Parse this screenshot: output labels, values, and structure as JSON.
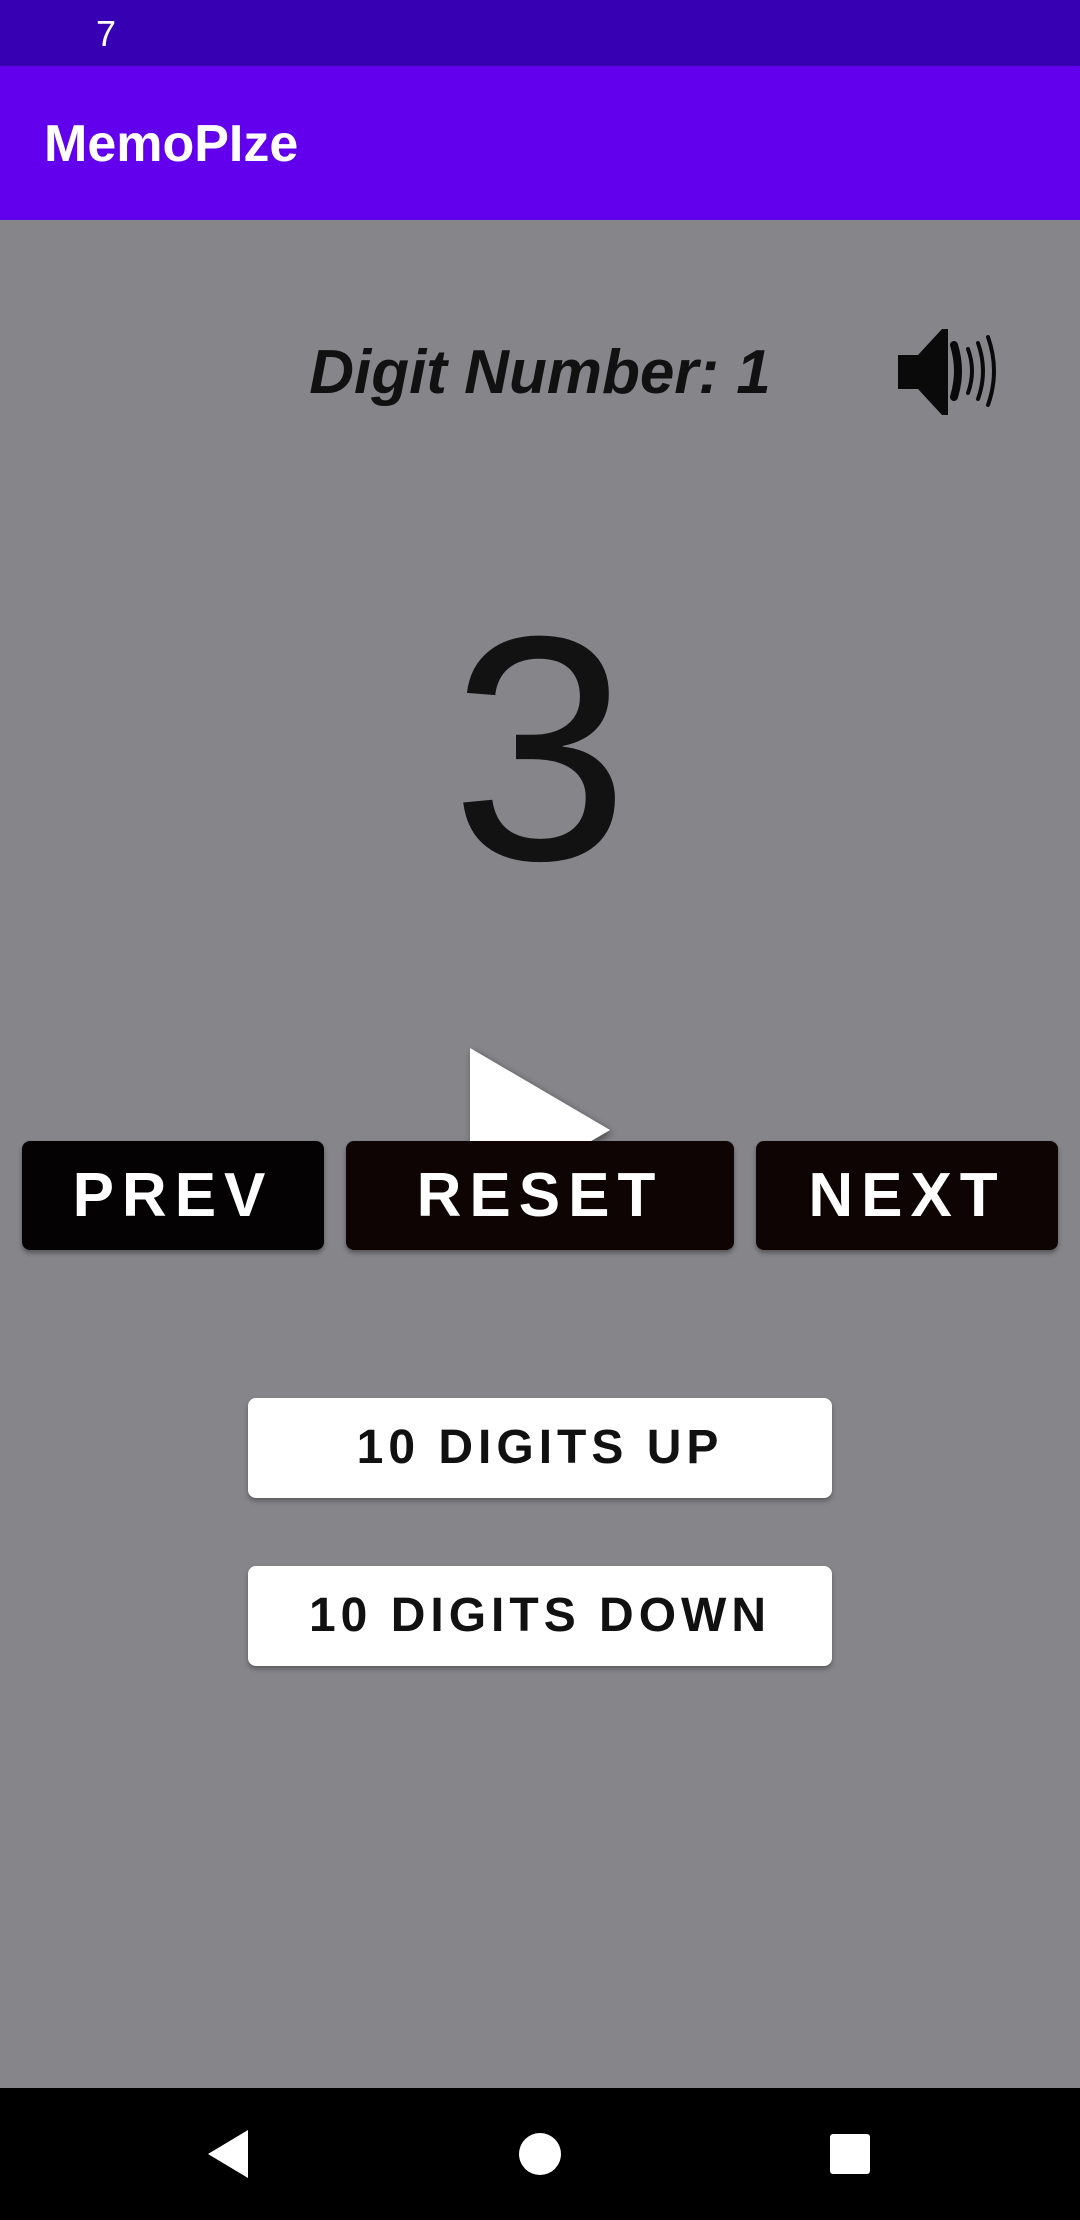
{
  "status_bar": {
    "time": "7"
  },
  "app_bar": {
    "title": "MemoPIze"
  },
  "main": {
    "digit_label": "Digit Number: 1",
    "current_digit": "3",
    "icons": {
      "sound": "speaker-volume-icon",
      "play": "play-icon"
    }
  },
  "controls": {
    "prev_label": "PREV",
    "reset_label": "RESET",
    "next_label": "NEXT",
    "up_label": "10 DIGITS UP",
    "down_label": "10 DIGITS DOWN"
  },
  "system_nav": {
    "back_icon": "back-triangle-icon",
    "home_icon": "home-circle-icon",
    "recents_icon": "recents-square-icon"
  },
  "colors": {
    "status_bar": "#3700b3",
    "app_bar": "#6200ee",
    "background": "#85858a",
    "button_dark": "#0e0404",
    "button_light": "#ffffff"
  }
}
